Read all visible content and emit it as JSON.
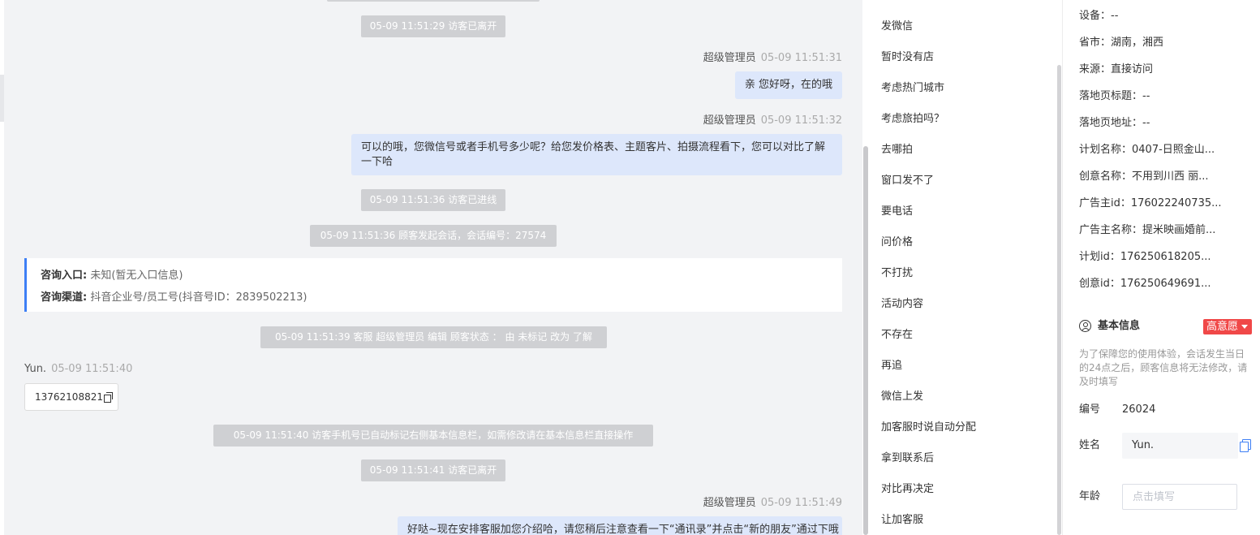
{
  "chat": {
    "system": {
      "left_1": "05-09 11:51:29 访客已离开",
      "entered": "05-09 11:51:36 访客已进线",
      "session_start": "05-09 11:51:36 顾客发起会话，会话编号：27574",
      "status_change": "05-09 11:51:39 客服 超级管理员 编辑 顾客状态 ： 由 未标记 改为 了解",
      "auto_mark": "05-09 11:51:40 访客手机号已自动标记右侧基本信息栏，如需修改请在基本信息栏直接操作",
      "left_2": "05-09 11:51:41 访客已离开"
    },
    "agent_name": "超级管理员",
    "visitor_name": "Yun.",
    "msg1": {
      "time": "05-09 11:51:31",
      "text": "亲 您好呀，在的哦"
    },
    "msg2": {
      "time": "05-09 11:51:32",
      "text": "可以的哦，您微信号或者手机号多少呢？给您发价格表、主题客片、拍摄流程看下，您可以对比了解一下哈"
    },
    "info_card": {
      "entry_label": "咨询入口:",
      "entry_value": "未知(暂无入口信息)",
      "channel_label": "咨询渠道:",
      "channel_value": "抖音企业号/员工号(抖音号ID：2839502213)"
    },
    "visitor_msg": {
      "time": "05-09 11:51:40",
      "phone": "13762108821"
    },
    "msg3": {
      "time": "05-09 11:51:49",
      "text": "好哒~现在安排客服加您介绍哈，请您稍后注意查看一下“通讯录”并点击“新的朋友”通过下哦"
    }
  },
  "quick_replies": {
    "items": [
      "发微信",
      "暂时没有店",
      "考虑热门城市",
      "考虑旅拍吗？",
      "去哪拍",
      "窗口发不了",
      "要电话",
      "问价格",
      "不打扰",
      "活动内容",
      "不存在",
      "再追",
      "微信上发",
      "加客服时说自动分配",
      "拿到联系后",
      "对比再决定",
      "让加客服"
    ]
  },
  "visitor_info": {
    "device": "设备：--",
    "province_city": "省市：湖南，湘西",
    "source": "来源：直接访问",
    "landing_title": "落地页标题：--",
    "landing_url": "落地页地址：--",
    "plan_name": "计划名称：0407-日照金山...",
    "creative_name": "创意名称：不用到川西 丽...",
    "advertiser_id": "广告主id：176022240735...",
    "advertiser_name": "广告主名称：提米映画婚前...",
    "plan_id": "计划id：176250618205...",
    "creative_id": "创意id：176250649691..."
  },
  "basic_info": {
    "title": "基本信息",
    "intent_badge": "高意愿",
    "notice": "为了保障您的使用体验，会话发生当日的24点之后，顾客信息将无法修改，请及时填写",
    "number_label": "编号",
    "number_value": "26024",
    "name_label": "姓名",
    "name_value": "Yun.",
    "age_label": "年龄",
    "age_placeholder": "点击填写"
  },
  "colors": {
    "accent": "#3d7ff5",
    "agent_bubble": "#dde7fb",
    "system_pill": "#cfd0d3",
    "badge_red": "#f04848"
  }
}
